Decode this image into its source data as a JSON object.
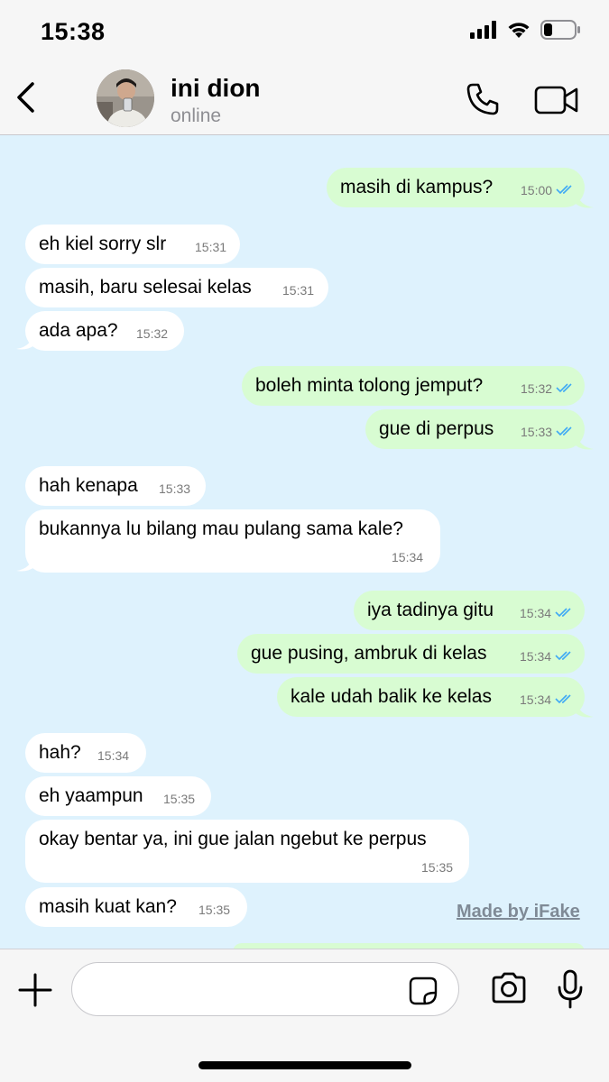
{
  "status_bar": {
    "time": "15:38"
  },
  "header": {
    "contact_name": "ini dion",
    "contact_status": "online"
  },
  "messages": [
    {
      "direction": "out",
      "text": "masih di kampus?",
      "time": "15:00",
      "read": true
    },
    {
      "direction": "in",
      "text": "eh kiel sorry slr",
      "time": "15:31"
    },
    {
      "direction": "in",
      "text": "masih, baru selesai kelas",
      "time": "15:31"
    },
    {
      "direction": "in",
      "text": "ada apa?",
      "time": "15:32"
    },
    {
      "direction": "out",
      "text": "boleh minta tolong jemput?",
      "time": "15:32",
      "read": true
    },
    {
      "direction": "out",
      "text": "gue di perpus",
      "time": "15:33",
      "read": true
    },
    {
      "direction": "in",
      "text": "hah kenapa",
      "time": "15:33"
    },
    {
      "direction": "in",
      "text": "bukannya lu bilang mau pulang sama kale?",
      "time": "15:34"
    },
    {
      "direction": "out",
      "text": "iya tadinya gitu",
      "time": "15:34",
      "read": true
    },
    {
      "direction": "out",
      "text": "gue pusing, ambruk di kelas",
      "time": "15:34",
      "read": true
    },
    {
      "direction": "out",
      "text": "kale udah balik ke kelas",
      "time": "15:34",
      "read": true
    },
    {
      "direction": "in",
      "text": "hah?",
      "time": "15:34"
    },
    {
      "direction": "in",
      "text": "eh yaampun",
      "time": "15:35"
    },
    {
      "direction": "in",
      "text": "okay bentar ya, ini gue jalan ngebut ke perpus",
      "time": "15:35"
    },
    {
      "direction": "in",
      "text": "masih kuat kan?",
      "time": "15:35"
    }
  ],
  "watermark": "Made by iFake",
  "colors": {
    "chat_background": "#def2fd",
    "outgoing_bubble": "#d8fcd2",
    "incoming_bubble": "#ffffff",
    "read_ticks": "#3fa9f5"
  },
  "icons": {
    "back": "chevron-left-icon",
    "call": "phone-icon",
    "video": "video-camera-icon",
    "plus": "plus-icon",
    "sticker": "sticker-icon",
    "camera": "camera-icon",
    "mic": "microphone-icon"
  }
}
